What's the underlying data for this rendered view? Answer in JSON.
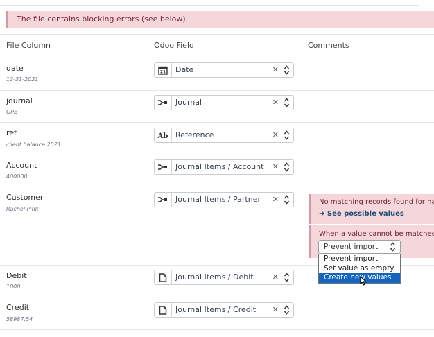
{
  "alert": "The file contains blocking errors (see below)",
  "headers": {
    "file_column": "File Column",
    "odoo_field": "Odoo Field",
    "comments": "Comments"
  },
  "rows": [
    {
      "column": "date",
      "sample": "12-31-2021",
      "field": "Date",
      "icon": "calendar-icon"
    },
    {
      "column": "journal",
      "sample": "OPB",
      "field": "Journal",
      "icon": "relation-icon"
    },
    {
      "column": "ref",
      "sample": "client balance 2021",
      "field": "Reference",
      "icon": "text-icon"
    },
    {
      "column": "Account",
      "sample": "400000",
      "field": "Journal Items / Account",
      "icon": "relation-icon"
    },
    {
      "column": "Customer",
      "sample": "Rachel Pink",
      "field": "Journal Items / Partner",
      "icon": "relation-icon"
    },
    {
      "column": "Debit",
      "sample": "1000",
      "field": "Journal Items / Debit",
      "icon": "monetary-icon"
    },
    {
      "column": "Credit",
      "sample": "58987.54",
      "field": "Journal Items / Credit",
      "icon": "monetary-icon"
    }
  ],
  "customer_comment": {
    "message": "No matching records found for nam",
    "link": "See possible values",
    "unmatched_label": "When a value cannot be matched:",
    "selected": "Prevent import",
    "options": [
      "Prevent import",
      "Set value as empty",
      "Create new values"
    ],
    "highlighted_option": "Create new values"
  },
  "colors": {
    "error_bg": "#f5d7db",
    "error_border": "#d39aa3",
    "highlight": "#1565c0"
  }
}
